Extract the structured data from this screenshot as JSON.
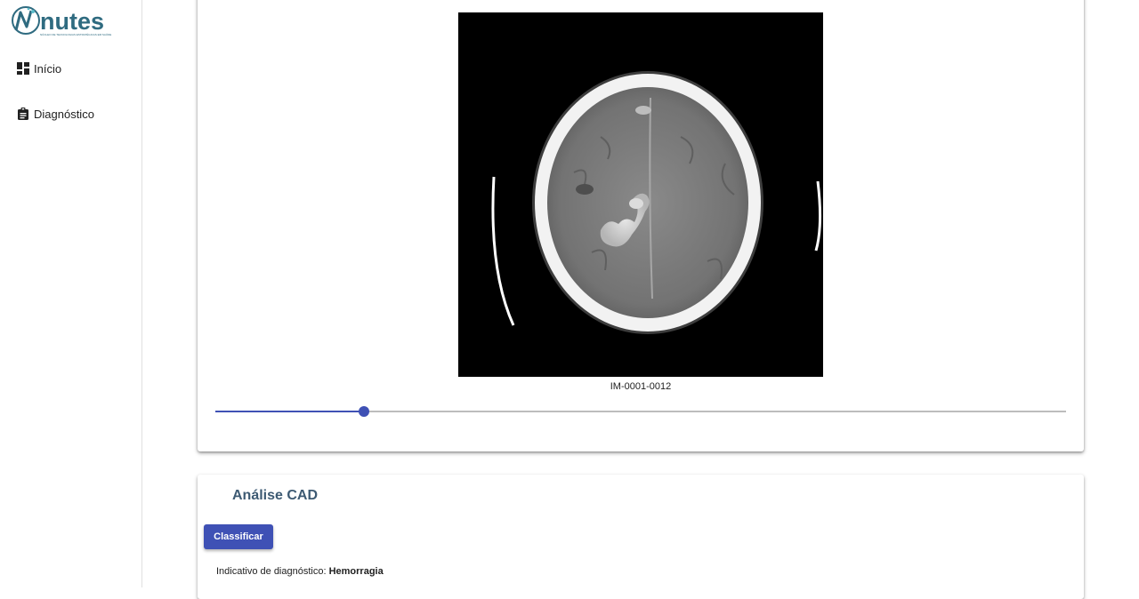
{
  "sidebar": {
    "logo_text": "nutes",
    "logo_subtitle": "NÚCLEO DE TECNOLOGIAS ESTRATÉGICAS EM SAÚDE",
    "items": [
      {
        "label": "Início",
        "icon": "dashboard-icon"
      },
      {
        "label": "Diagnóstico",
        "icon": "clipboard-icon"
      }
    ]
  },
  "viewer": {
    "image_label": "IM-0001-0012",
    "slider_value_fraction": 0.175
  },
  "cad": {
    "title": "Análise CAD",
    "classify_label": "Classificar",
    "diagnosis_prefix": "Indicativo de diagnóstico:",
    "diagnosis_value": "Hemorragia"
  },
  "colors": {
    "accent": "#3f51b5",
    "title": "#3d5a73",
    "logo": "#2f6b80",
    "logo_accent": "#5bbcc9"
  }
}
